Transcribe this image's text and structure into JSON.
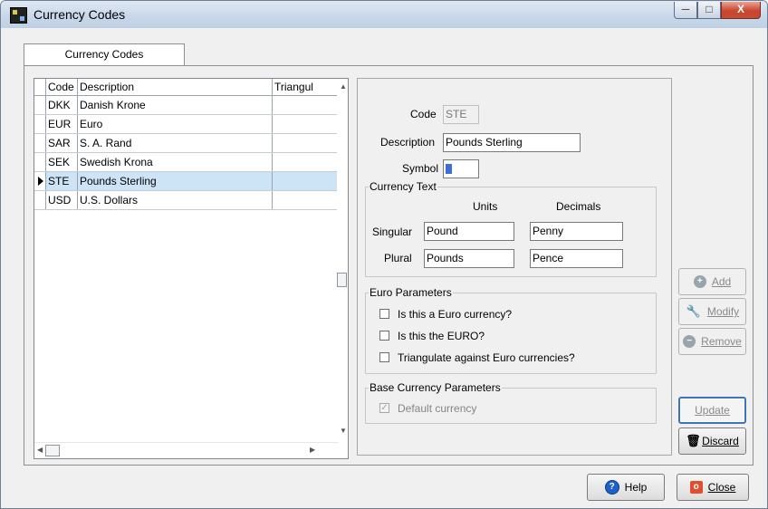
{
  "window": {
    "title": "Currency Codes",
    "min_symbol": "─",
    "max_symbol": "□",
    "close_symbol": "X"
  },
  "tabs": [
    "Currency Codes"
  ],
  "grid": {
    "columns": [
      "Code",
      "Description",
      "Triangul"
    ],
    "rows": [
      {
        "code": "DKK",
        "description": "Danish Krone",
        "triangulate": ""
      },
      {
        "code": "EUR",
        "description": "Euro",
        "triangulate": ""
      },
      {
        "code": "SAR",
        "description": "S. A. Rand",
        "triangulate": ""
      },
      {
        "code": "SEK",
        "description": "Swedish Krona",
        "triangulate": ""
      },
      {
        "code": "STE",
        "description": "Pounds Sterling",
        "triangulate": ""
      },
      {
        "code": "USD",
        "description": "U.S. Dollars",
        "triangulate": ""
      }
    ],
    "selected_row": 4
  },
  "detail": {
    "code_label": "Code",
    "code_value": "STE",
    "description_label": "Description",
    "description_value": "Pounds Sterling",
    "symbol_label": "Symbol",
    "symbol_value": "£",
    "currency_text_title": "Currency Text",
    "units_label": "Units",
    "decimals_label": "Decimals",
    "singular_label": "Singular",
    "singular_units": "Pound",
    "singular_decimals": "Penny",
    "plural_label": "Plural",
    "plural_units": "Pounds",
    "plural_decimals": "Pence",
    "euro_title": "Euro Parameters",
    "euro_option_1": "Is this a Euro currency?",
    "euro_option_2": "Is this the EURO?",
    "euro_option_3": "Triangulate against Euro currencies?",
    "base_title": "Base Currency Parameters",
    "default_currency": "Default currency"
  },
  "buttons": {
    "add": "Add",
    "modify": "Modify",
    "remove": "Remove",
    "update": "Update",
    "discard": "Discard",
    "help": "Help",
    "close": "Close"
  },
  "colors": {
    "selection": "#cde4f7",
    "help_blue": "#1d61c9",
    "close_red": "#df4e2f"
  }
}
